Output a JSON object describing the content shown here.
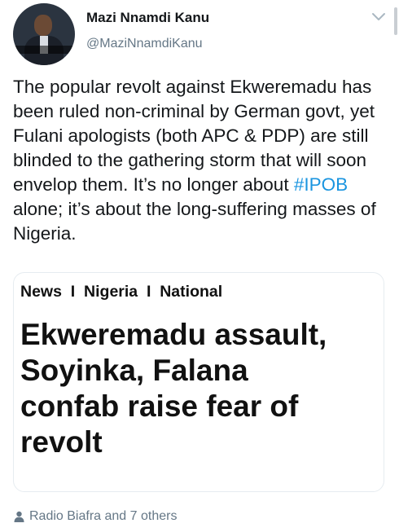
{
  "author": {
    "display_name": "Mazi Nnamdi Kanu",
    "handle": "@MaziNnamdiKanu"
  },
  "tweet": {
    "text_before": "The popular revolt against Ekweremadu has been ruled non-criminal by German govt, yet Fulani apologists (both APC & PDP) are still blinded to the gathering storm that will soon envelop them. It’s no longer about ",
    "hashtag": "#IPOB",
    "text_after": " alone; it’s about the long-suffering masses of Nigeria."
  },
  "card": {
    "breadcrumb": "News  I  Nigeria  I  National",
    "headline_lines": [
      "Ekweremadu assault,",
      "Soyinka, Falana",
      "confab raise fear of",
      "revolt"
    ]
  },
  "footer": {
    "text": "Radio Biafra and 7 others"
  },
  "icons": {
    "menu": "chevron-down-icon",
    "footer": "person-icon"
  },
  "colors": {
    "link": "#1b95e0",
    "secondary_text": "#657786",
    "primary_text": "#14171a",
    "border": "#e6ecf0"
  }
}
